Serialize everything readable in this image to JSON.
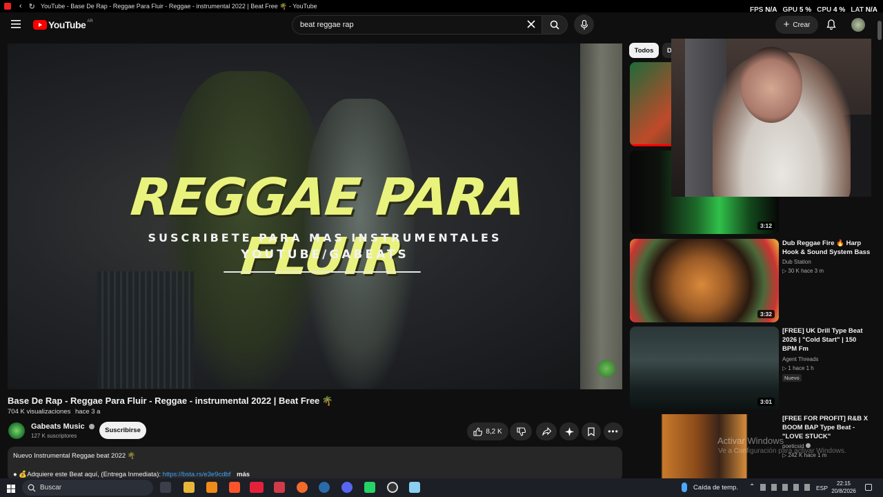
{
  "browser": {
    "tab_title": "YouTube - Base De Rap - Reggae Para Fluir - Reggae - instrumental 2022 | Beat Free 🌴 - YouTube"
  },
  "overlay": {
    "fps_label": "FPS",
    "fps_value": "N/A",
    "gpu_label": "GPU",
    "gpu_value": "5 %",
    "cpu_label": "CPU",
    "cpu_value": "4 %",
    "lat_label": "LAT",
    "lat_value": "N/A"
  },
  "header": {
    "logo_text": "YouTube",
    "country": "AR",
    "search_value": "beat reggae rap",
    "create_label": "Crear"
  },
  "video": {
    "thumb_title": "REGGAE PARA FLUIR",
    "thumb_sub1": "SUSCRIBETE PARA MAS INSTRUMENTALES",
    "thumb_sub2": "YOUTUBE/GABEATS",
    "title": "Base De Rap - Reggae Para Fluir - Reggae - instrumental 2022 | Beat Free 🌴",
    "views": "704 K visualizaciones",
    "age": "hace 3 a",
    "channel": "Gabeats Music",
    "subscribers": "127 K suscriptores",
    "subscribe_label": "Suscribirse",
    "likes": "8,2 K",
    "description_line1": "Nuevo Instrumental Reggae beat 2022 🌴",
    "description_line2_prefix": "● 💰Adquiere este Beat aquí, (Entrega Inmediata): ",
    "description_link": "https://bsta.rs/e3e9cdbf",
    "more_label": "más"
  },
  "chips": [
    "Todos",
    "D"
  ],
  "recommendations": [
    {
      "duration": "",
      "title": "",
      "channel": "",
      "meta": ""
    },
    {
      "duration": "3:12",
      "title": "",
      "channel": "",
      "meta": ""
    },
    {
      "duration": "3:32",
      "title": "Dub Reggae Fire 🔥 Harp Hook & Sound System Bass",
      "channel": "Dub Station",
      "views": "30 K",
      "age": "hace 3 m"
    },
    {
      "duration": "3:01",
      "title": "[FREE] UK Drill Type Beat 2026 | \"Cold Start\" | 150 BPM Fm",
      "channel": "Agent Threads",
      "views": "1",
      "age": "hace 1 h",
      "badge": "Nuevo"
    },
    {
      "duration": "",
      "title": "[FREE FOR PROFIT] R&B X BOOM BAP Type Beat - \"LOVE STUCK\"",
      "channel": "poeticsid",
      "views": "242 K",
      "age": "hace 1 m"
    }
  ],
  "windows": {
    "activate_title": "Activar Windows",
    "activate_sub": "Ve a Configuración para activar Windows.",
    "search_label": "Buscar",
    "weather": "Caída de temp.",
    "language": "ESP",
    "time": "22:15",
    "date": "20/8/2026"
  },
  "colors": {
    "background": "#0f0f0f",
    "yt_red": "#ff0000",
    "link": "#3ea6ff",
    "thumb_text": "#e9f27d"
  }
}
